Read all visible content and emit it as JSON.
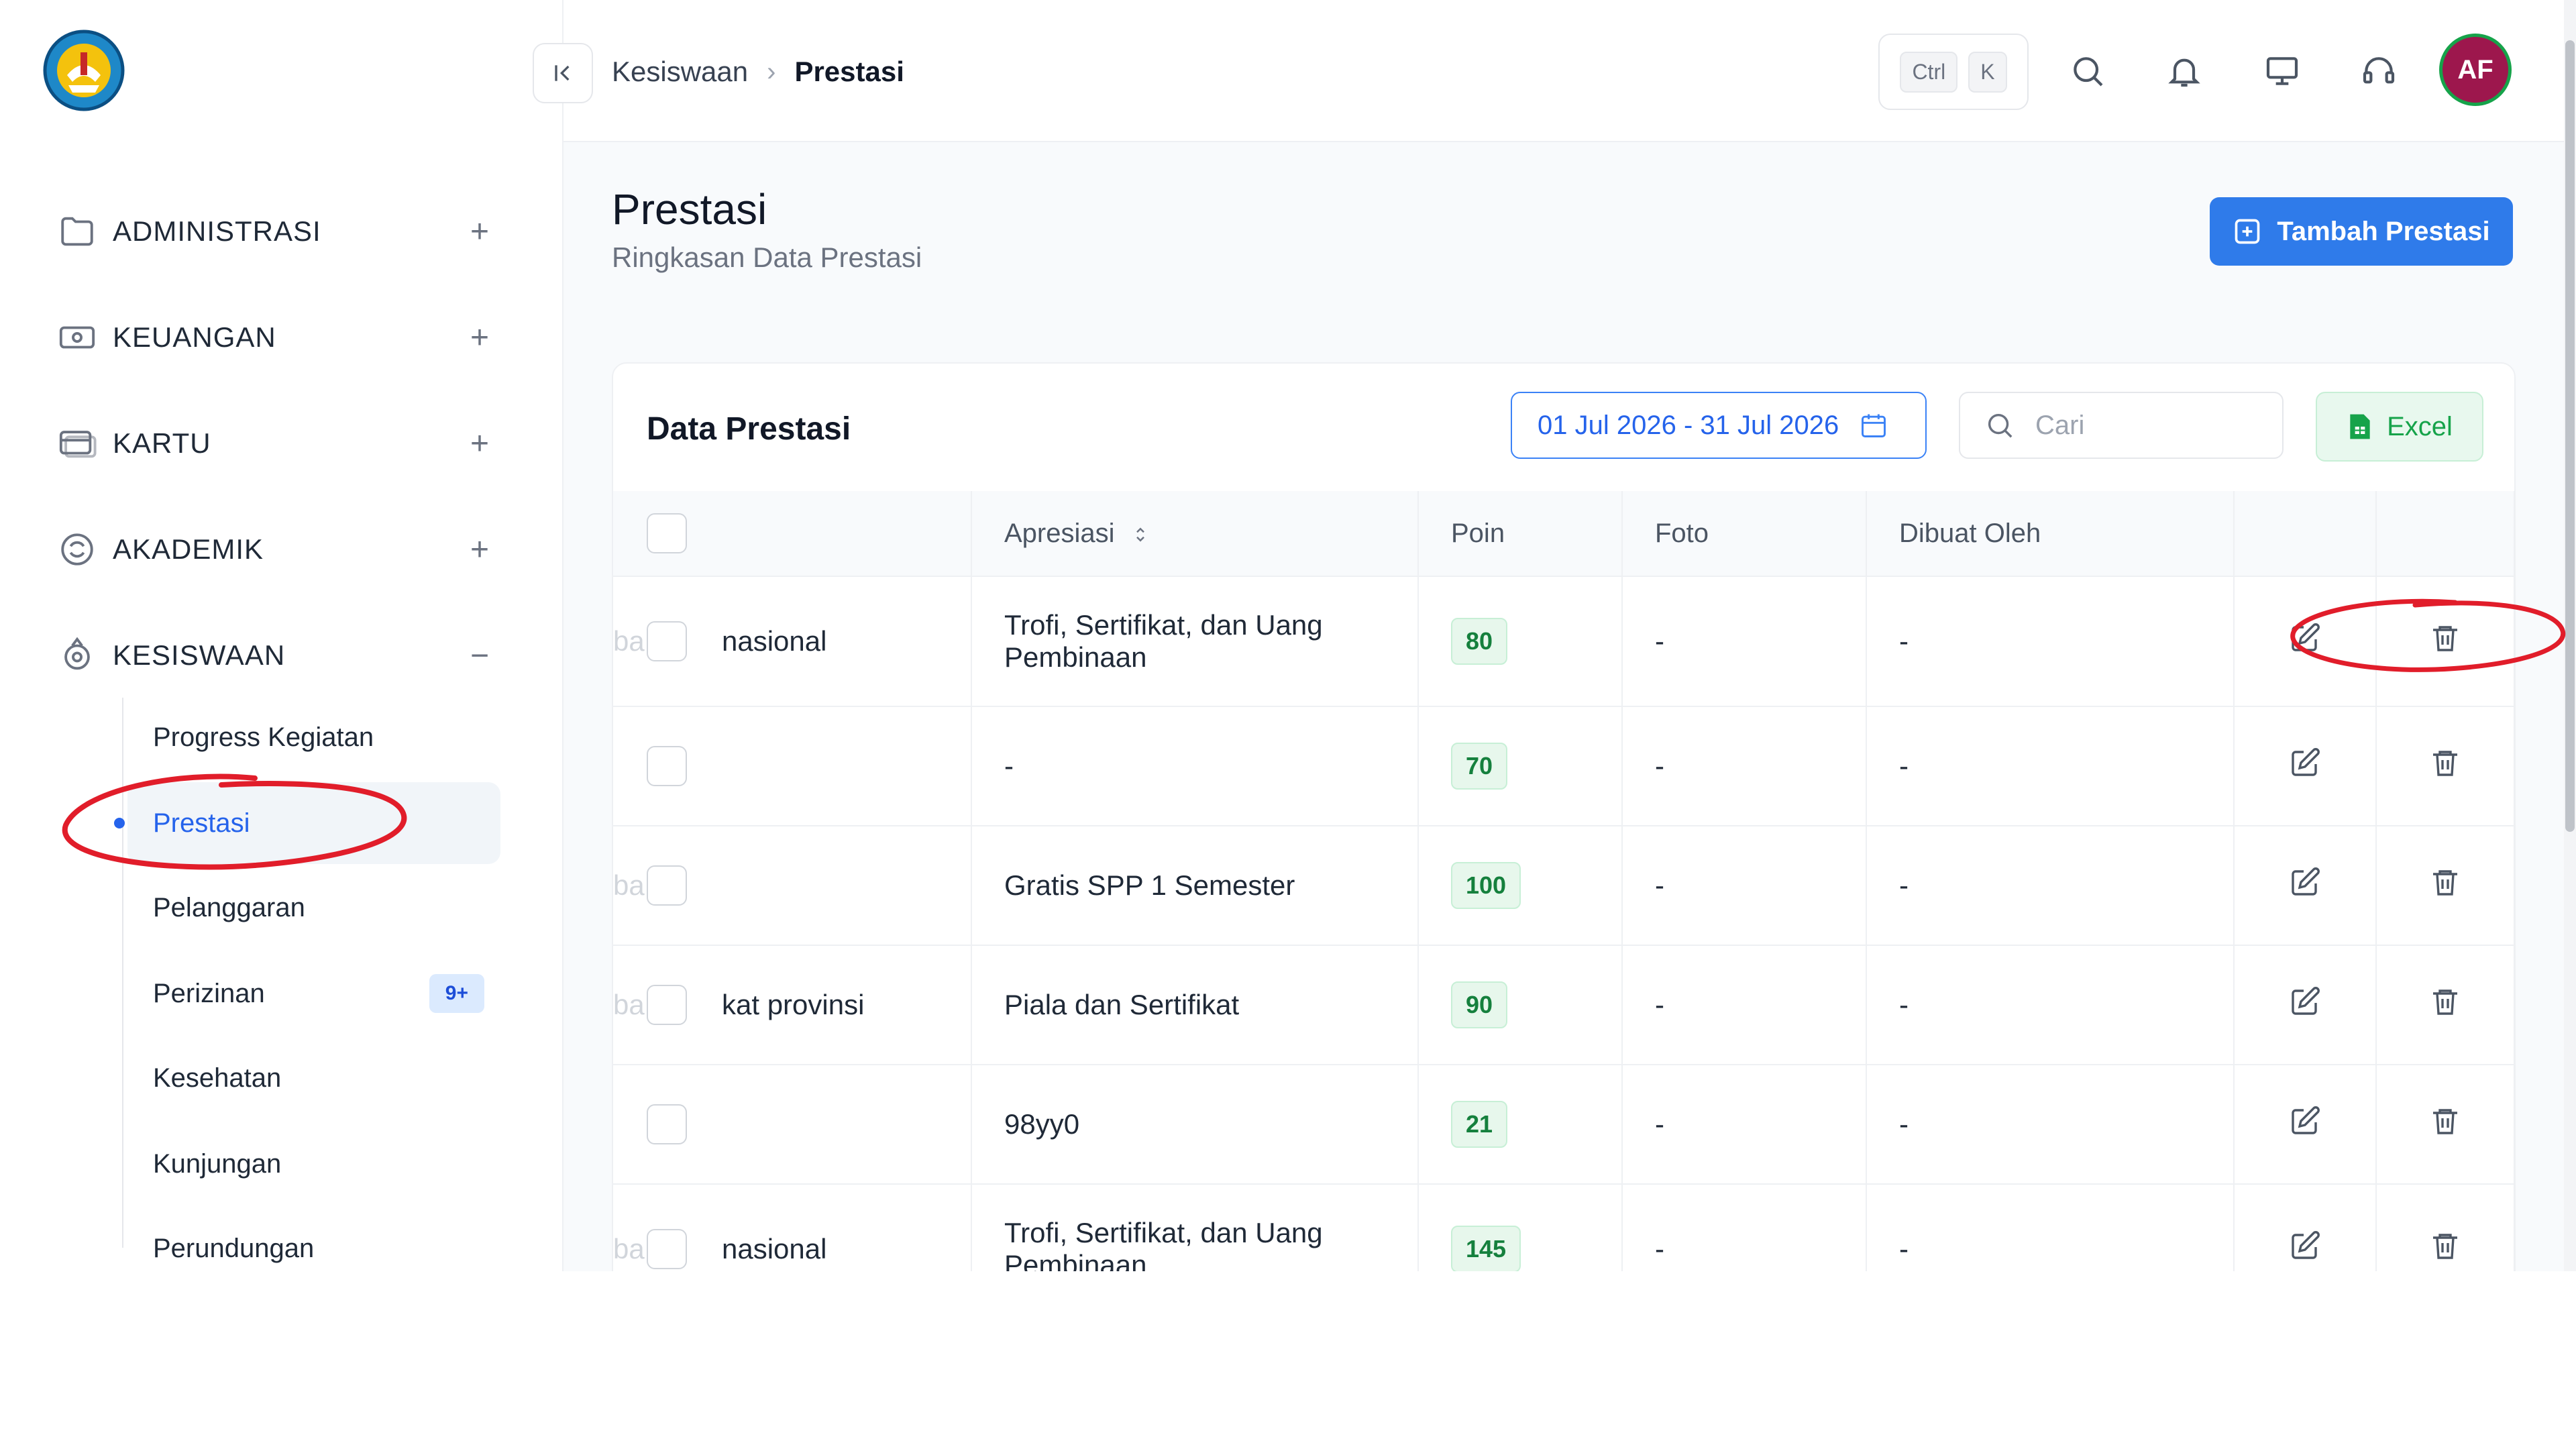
{
  "breadcrumb": {
    "parent": "Kesiswaan",
    "current": "Prestasi"
  },
  "shortcut": {
    "key1": "Ctrl",
    "key2": "K"
  },
  "user": {
    "initials": "AF"
  },
  "sidebar": {
    "sections": [
      {
        "label": "ADMINISTRASI",
        "icon": "folder-icon",
        "state": "+"
      },
      {
        "label": "KEUANGAN",
        "icon": "money-icon",
        "state": "+"
      },
      {
        "label": "KARTU",
        "icon": "card-icon",
        "state": "+"
      },
      {
        "label": "AKADEMIK",
        "icon": "academic-icon",
        "state": "+"
      },
      {
        "label": "KESISWAAN",
        "icon": "student-icon",
        "state": "−"
      }
    ],
    "sub_items": [
      {
        "label": "Progress Kegiatan"
      },
      {
        "label": "Prestasi",
        "active": true
      },
      {
        "label": "Pelanggaran"
      },
      {
        "label": "Perizinan",
        "badge": "9+"
      },
      {
        "label": "Kesehatan"
      },
      {
        "label": "Kunjungan"
      },
      {
        "label": "Perundungan"
      }
    ]
  },
  "page": {
    "title": "Prestasi",
    "subtitle": "Ringkasan Data Prestasi",
    "add_button": "Tambah Prestasi"
  },
  "card": {
    "title": "Data Prestasi",
    "date_range": "01 Jul 2026 - 31 Jul 2026",
    "search_placeholder": "Cari",
    "excel_button": "Excel"
  },
  "table": {
    "columns": [
      "Apresiasi",
      "Poin",
      "Foto",
      "Dibuat Oleh"
    ],
    "rows": [
      {
        "first_hidden": "ba",
        "first": "nasional",
        "apresiasi": "Trofi, Sertifikat, dan Uang Pembinaan",
        "poin": "80",
        "foto": "-",
        "dibuat_oleh": "-"
      },
      {
        "first_hidden": "",
        "first": "",
        "apresiasi": "-",
        "poin": "70",
        "foto": "-",
        "dibuat_oleh": "-"
      },
      {
        "first_hidden": "ba",
        "first": "",
        "apresiasi": "Gratis SPP 1 Semester",
        "poin": "100",
        "foto": "-",
        "dibuat_oleh": "-"
      },
      {
        "first_hidden": "ba",
        "first": "kat provinsi",
        "apresiasi": "Piala dan Sertifikat",
        "poin": "90",
        "foto": "-",
        "dibuat_oleh": "-"
      },
      {
        "first_hidden": "",
        "first": "",
        "apresiasi": "98yy0",
        "poin": "21",
        "foto": "-",
        "dibuat_oleh": "-"
      },
      {
        "first_hidden": "ba",
        "first": "nasional",
        "apresiasi": "Trofi, Sertifikat, dan Uang Pembinaan",
        "poin": "145",
        "foto": "-",
        "dibuat_oleh": "-"
      }
    ]
  },
  "colors": {
    "primary": "#2f7bea",
    "success": "#16a34a",
    "annotation": "#e11d2a",
    "avatar": "#9d174d"
  }
}
